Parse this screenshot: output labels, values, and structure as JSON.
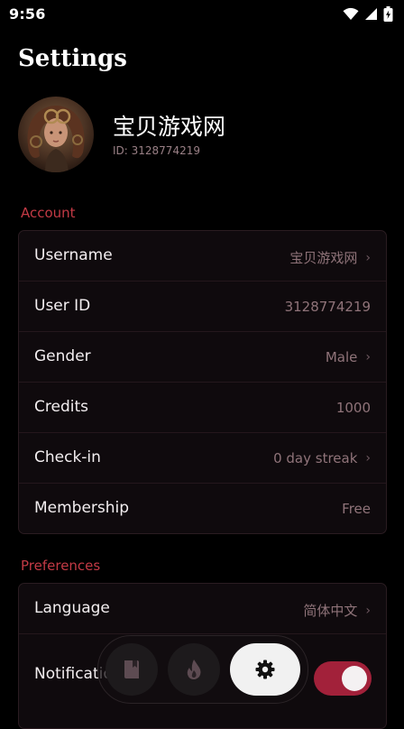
{
  "status_bar": {
    "time": "9:56"
  },
  "page": {
    "title": "Settings"
  },
  "profile": {
    "name": "宝贝游戏网",
    "id_text": "ID: 3128774219"
  },
  "sections": {
    "account": {
      "label": "Account",
      "rows": [
        {
          "label": "Username",
          "value": "宝贝游戏网",
          "chevron": true
        },
        {
          "label": "User ID",
          "value": "3128774219",
          "chevron": false
        },
        {
          "label": "Gender",
          "value": "Male",
          "chevron": true
        },
        {
          "label": "Credits",
          "value": "1000",
          "chevron": false
        },
        {
          "label": "Check-in",
          "value": "0 day streak",
          "chevron": true
        },
        {
          "label": "Membership",
          "value": "Free",
          "chevron": false
        }
      ]
    },
    "preferences": {
      "label": "Preferences",
      "rows": [
        {
          "label": "Language",
          "value": "简体中文",
          "chevron": true
        },
        {
          "label": "Notifications",
          "toggle_on": true
        }
      ]
    }
  },
  "bottom_nav": {
    "items": [
      {
        "icon": "book-icon",
        "active": false
      },
      {
        "icon": "flame-icon",
        "active": false
      },
      {
        "icon": "gear-icon",
        "active": true
      }
    ]
  },
  "colors": {
    "accent": "#c33a45",
    "toggle": "#a2213a",
    "background": "#000000"
  }
}
